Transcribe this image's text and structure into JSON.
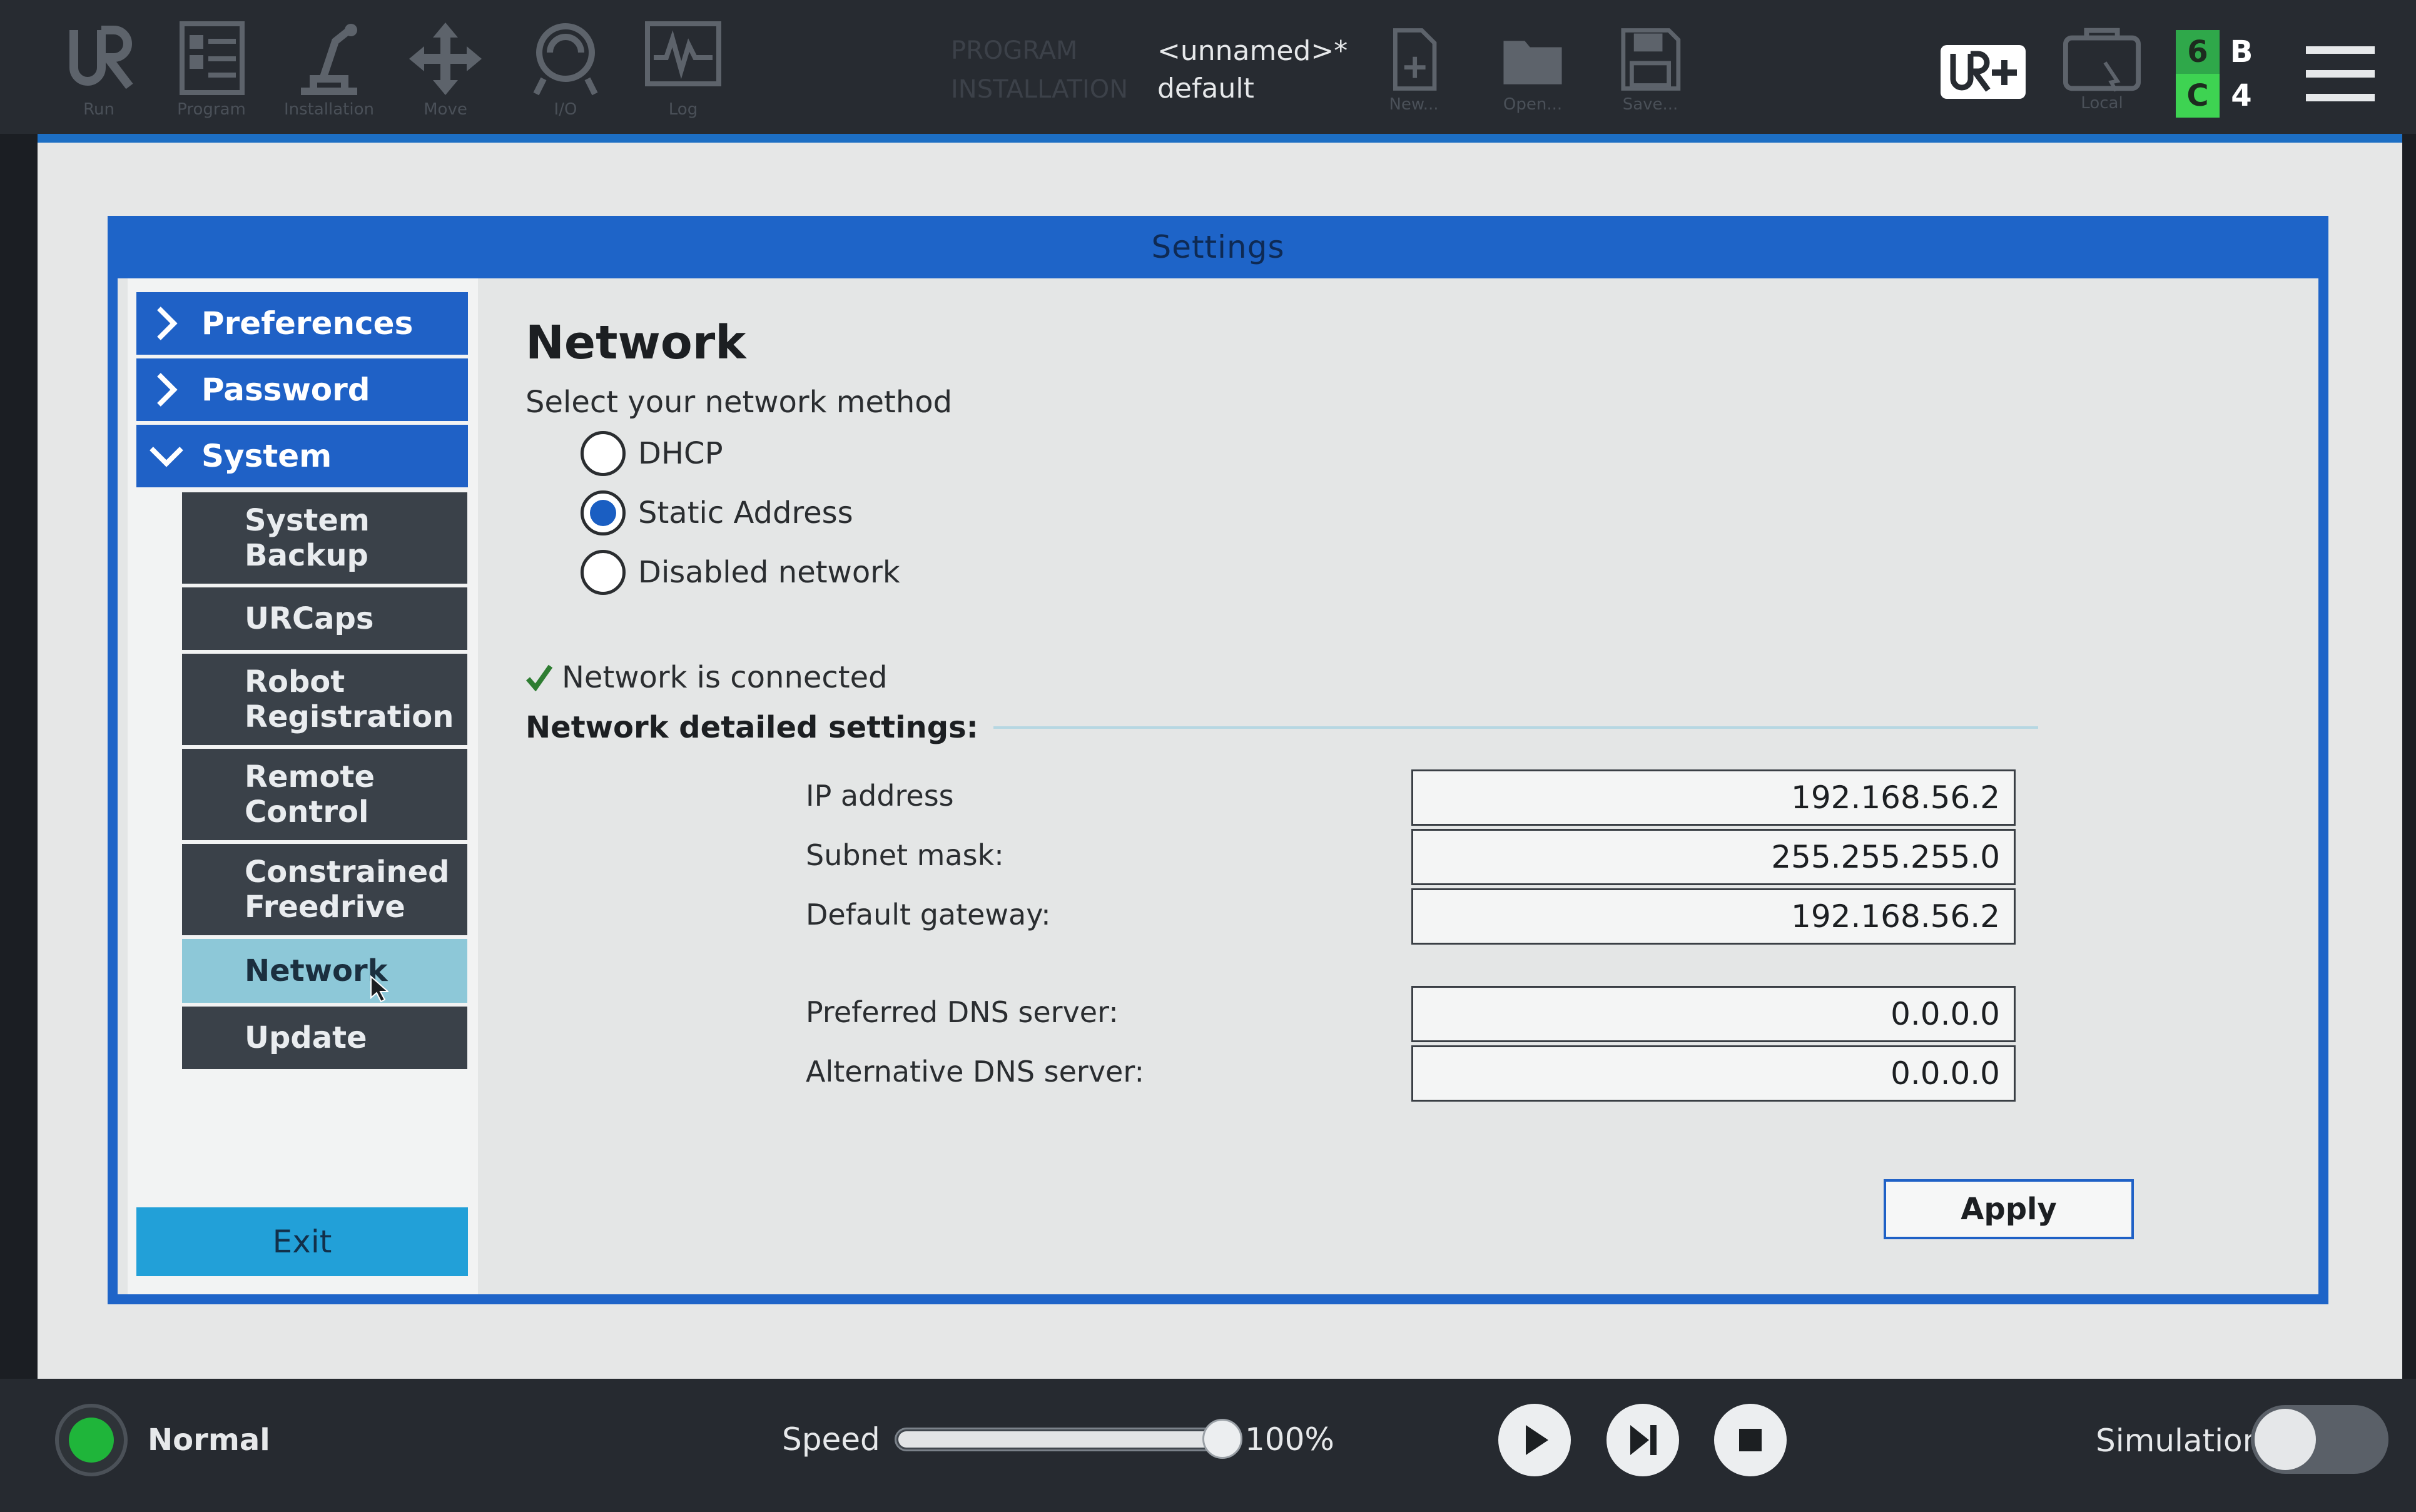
{
  "topbar": {
    "nav": [
      {
        "label": "Run"
      },
      {
        "label": "Program"
      },
      {
        "label": "Installation"
      },
      {
        "label": "Move"
      },
      {
        "label": "I/O"
      },
      {
        "label": "Log"
      }
    ],
    "program_label": "PROGRAM",
    "installation_label": "INSTALLATION",
    "program_name": "<unnamed>*",
    "installation_name": "default",
    "file_buttons": [
      {
        "label": "New..."
      },
      {
        "label": "Open..."
      },
      {
        "label": "Save..."
      }
    ],
    "local_label": "Local",
    "counters": {
      "a": "6",
      "b": "B",
      "c": "C",
      "d": "4"
    }
  },
  "dialog": {
    "title": "Settings",
    "sidebar": {
      "categories": [
        {
          "label": "Preferences"
        },
        {
          "label": "Password"
        },
        {
          "label": "System"
        }
      ],
      "system_items": [
        {
          "label": "System Backup"
        },
        {
          "label": "URCaps"
        },
        {
          "label": "Robot Registration"
        },
        {
          "label": "Remote Control"
        },
        {
          "label": "Constrained Freedrive"
        },
        {
          "label": "Network"
        },
        {
          "label": "Update"
        }
      ],
      "active_item": "Network",
      "exit_label": "Exit"
    },
    "network": {
      "title": "Network",
      "method_label": "Select your network method",
      "methods": [
        {
          "label": "DHCP",
          "selected": false
        },
        {
          "label": "Static Address",
          "selected": true
        },
        {
          "label": "Disabled network",
          "selected": false
        }
      ],
      "status": "Network is connected",
      "detail_heading": "Network detailed settings:",
      "fields": {
        "ip_label": "IP address",
        "ip_value": "192.168.56.2",
        "subnet_label": "Subnet mask:",
        "subnet_value": "255.255.255.0",
        "gateway_label": "Default gateway:",
        "gateway_value": "192.168.56.2",
        "dns1_label": "Preferred DNS server:",
        "dns1_value": "0.0.0.0",
        "dns2_label": "Alternative DNS server:",
        "dns2_value": "0.0.0.0"
      },
      "apply_label": "Apply"
    }
  },
  "bottombar": {
    "status": "Normal",
    "speed_label": "Speed",
    "speed_value": "100%",
    "speed_fraction": 1.0,
    "simulation_label": "Simulation",
    "simulation_on": false
  },
  "colors": {
    "accent_blue": "#1f61c6",
    "active_item": "#8dc8d8",
    "status_green": "#1fb53a",
    "counter_green": "#2fa84a",
    "counter_bright_green": "#3ed352"
  },
  "icons": [
    "ur-logo-icon",
    "program-icon",
    "installation-icon",
    "move-icon",
    "io-icon",
    "log-icon",
    "new-file-icon",
    "open-folder-icon",
    "save-icon",
    "ur-plus-icon",
    "local-icon",
    "hamburger-menu-icon",
    "chevron-right-icon",
    "chevron-down-icon",
    "checkmark-icon",
    "mouse-cursor-icon",
    "play-icon",
    "step-icon",
    "stop-icon"
  ]
}
